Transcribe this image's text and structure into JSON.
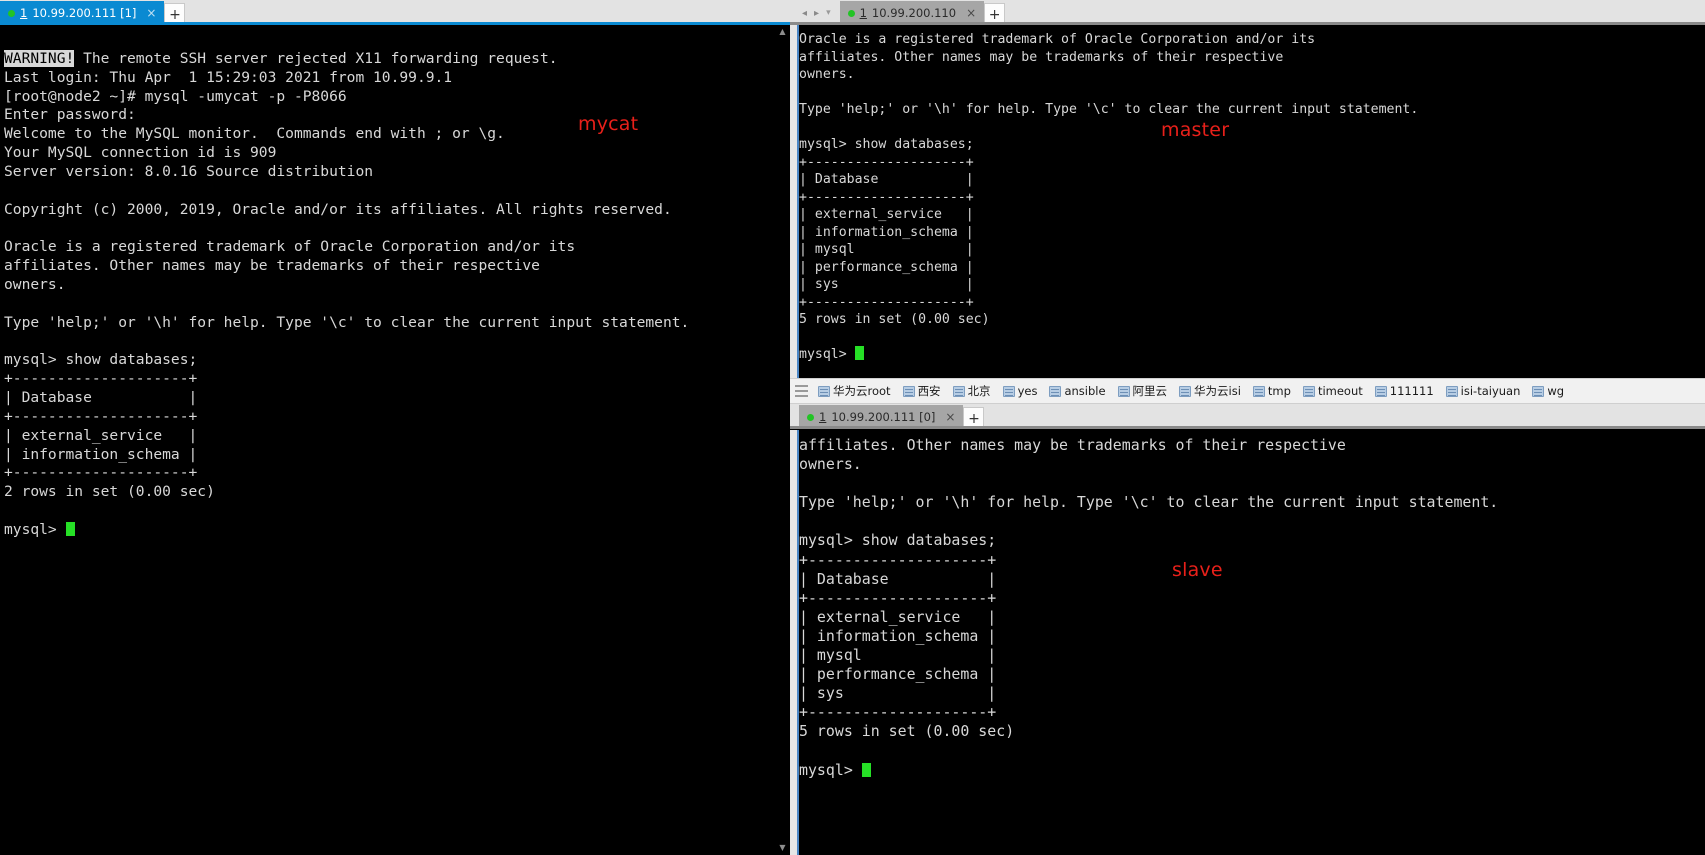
{
  "left_pane": {
    "tab": {
      "number": "1",
      "label": "10.99.200.111 [1]",
      "close": "×",
      "status_dot": "connected-green"
    },
    "new_tab_label": "+",
    "scroll_up": "▲",
    "scroll_down": "▼",
    "terminal_lines": [
      "",
      "WARNING! The remote SSH server rejected X11 forwarding request.",
      "Last login: Thu Apr  1 15:29:03 2021 from 10.99.9.1",
      "[root@node2 ~]# mysql -umycat -p -P8066",
      "Enter password:",
      "Welcome to the MySQL monitor.  Commands end with ; or \\g.",
      "Your MySQL connection id is 909",
      "Server version: 8.0.16 Source distribution",
      "",
      "Copyright (c) 2000, 2019, Oracle and/or its affiliates. All rights reserved.",
      "",
      "Oracle is a registered trademark of Oracle Corporation and/or its",
      "affiliates. Other names may be trademarks of their respective",
      "owners.",
      "",
      "Type 'help;' or '\\h' for help. Type '\\c' to clear the current input statement.",
      "",
      "mysql> show databases;",
      "+--------------------+",
      "| Database           |",
      "+--------------------+",
      "| external_service   |",
      "| information_schema |",
      "+--------------------+",
      "2 rows in set (0.00 sec)",
      "",
      "mysql> "
    ],
    "warning_token": "WARNING!",
    "prompt_tail": "mysql> ",
    "annotation": "mycat"
  },
  "right_top_pane": {
    "nav_back": "◂",
    "nav_fwd": "▸",
    "nav_menu": "▾",
    "tab": {
      "number": "1",
      "label": "10.99.200.110",
      "close": "×",
      "status_dot": "connected-green"
    },
    "new_tab_label": "+",
    "terminal_lines": [
      "Oracle is a registered trademark of Oracle Corporation and/or its",
      "affiliates. Other names may be trademarks of their respective",
      "owners.",
      "",
      "Type 'help;' or '\\h' for help. Type '\\c' to clear the current input statement.",
      "",
      "mysql> show databases;",
      "+--------------------+",
      "| Database           |",
      "+--------------------+",
      "| external_service   |",
      "| information_schema |",
      "| mysql              |",
      "| performance_schema |",
      "| sys                |",
      "+--------------------+",
      "5 rows in set (0.00 sec)",
      "",
      "mysql> "
    ],
    "prompt_tail": "mysql> ",
    "annotation": "master"
  },
  "bookmarks_bar": {
    "handle": "bookmarks-handle",
    "items": [
      {
        "label": "华为云root"
      },
      {
        "label": "西安"
      },
      {
        "label": "北京"
      },
      {
        "label": "yes"
      },
      {
        "label": "ansible"
      },
      {
        "label": "阿里云"
      },
      {
        "label": "华为云isi"
      },
      {
        "label": "tmp"
      },
      {
        "label": "timeout"
      },
      {
        "label": "111111"
      },
      {
        "label": "isi-taiyuan"
      },
      {
        "label": "wg"
      }
    ]
  },
  "right_bottom_pane": {
    "tab": {
      "number": "1",
      "label": "10.99.200.111 [0]",
      "close": "×",
      "status_dot": "connected-green"
    },
    "new_tab_label": "+",
    "terminal_lines": [
      "affiliates. Other names may be trademarks of their respective",
      "owners.",
      "",
      "Type 'help;' or '\\h' for help. Type '\\c' to clear the current input statement.",
      "",
      "mysql> show databases;",
      "+--------------------+",
      "| Database           |",
      "+--------------------+",
      "| external_service   |",
      "| information_schema |",
      "| mysql              |",
      "| performance_schema |",
      "| sys                |",
      "+--------------------+",
      "5 rows in set (0.00 sec)",
      "",
      "mysql> "
    ],
    "prompt_tail": "mysql> ",
    "annotation": "slave"
  },
  "colors": {
    "terminal_bg": "#000000",
    "terminal_fg": "#d8d8d8",
    "active_tab": "#0a8ad2",
    "inactive_tab": "#a6a6a6",
    "tabbar_bg": "#e3e3e3",
    "annotation_red": "#e8201a",
    "cursor_green": "#26e026",
    "bookmark_bar_bg": "#f1f1f1"
  }
}
